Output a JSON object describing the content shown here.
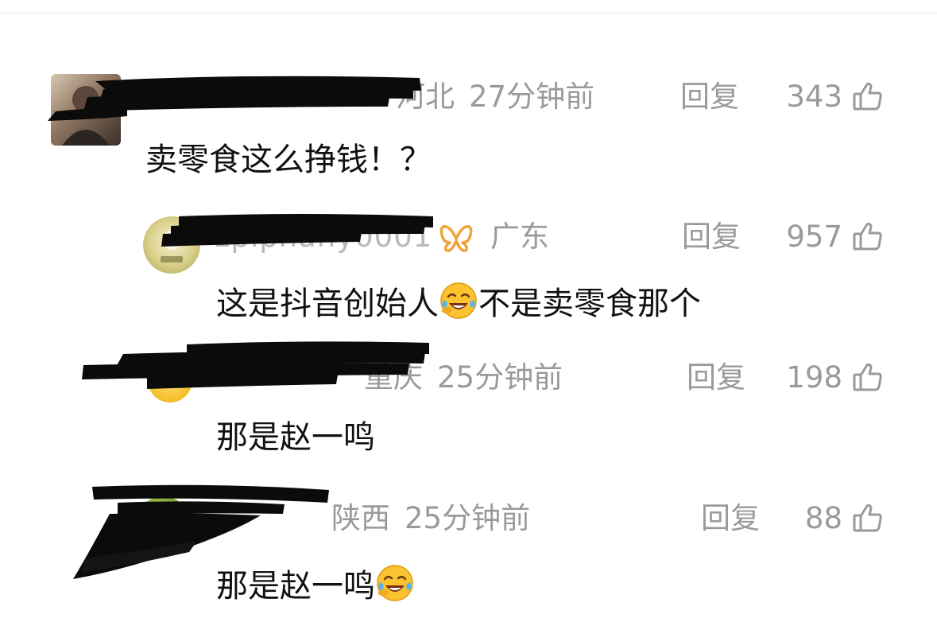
{
  "comments": [
    {
      "username": "",
      "location": "河北",
      "time": "27分钟前",
      "reply_label": "回复",
      "likes": "343",
      "text": "卖零食这么挣钱！？",
      "level": "top"
    },
    {
      "username": "zpiphany0001",
      "location": "广东",
      "time": "",
      "reply_label": "回复",
      "likes": "957",
      "text_before_emoji": "这是抖音创始人",
      "text_after_emoji": "不是卖零食那个",
      "level": "reply"
    },
    {
      "username": "",
      "location": "重庆",
      "time": "25分钟前",
      "reply_label": "回复",
      "likes": "198",
      "text": "那是赵一鸣",
      "level": "reply"
    },
    {
      "username": "",
      "location": "陕西",
      "time": "25分钟前",
      "reply_label": "回复",
      "likes": "88",
      "text": "那是赵一鸣",
      "level": "reply"
    }
  ],
  "icons": {
    "like": "thumbs-up-icon",
    "emoji": "face-with-tears-of-joy-icon",
    "badge": "butterfly-badge-icon"
  },
  "colors": {
    "meta_text": "#9a9a9a",
    "body_text": "#111111",
    "badge": "#f0a33a"
  }
}
